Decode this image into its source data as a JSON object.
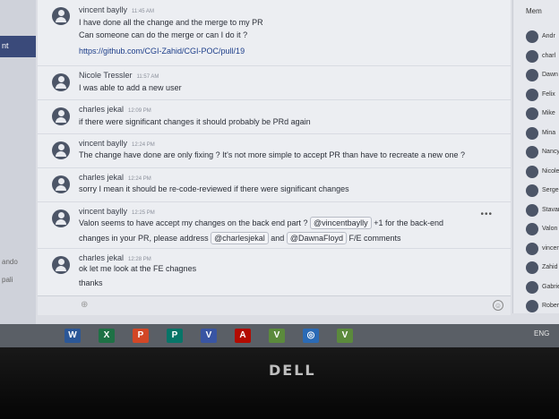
{
  "left_sidebar": {
    "active_item": "nt",
    "labels": [
      "ando",
      "pali"
    ]
  },
  "messages": [
    {
      "author": "vincent baylly",
      "time": "11:45 AM",
      "lines": [
        "I have done all the change and the merge to my PR",
        "Can someone can do the merge or can I do it ?"
      ],
      "link": "https://github.com/CGI-Zahid/CGI-POC/pull/19"
    },
    {
      "author": "Nicole Tressler",
      "time": "11:57 AM",
      "lines": [
        "I was able to add a new user"
      ]
    },
    {
      "author": "charles jekal",
      "time": "12:09 PM",
      "lines": [
        "if there were significant changes it should probably be PRd again"
      ]
    },
    {
      "author": "vincent baylly",
      "time": "12:24 PM",
      "lines": [
        "The change have done are only fixing ? It's not more simple to accept PR than have to recreate a new one ?"
      ]
    },
    {
      "author": "charles jekal",
      "time": "12:24 PM",
      "lines": [
        "sorry I mean it should be re-code-reviewed if there were significant changes"
      ]
    },
    {
      "author": "vincent baylly",
      "time": "12:25 PM",
      "line1_pre": "Valon seems to have accept my changes on the back end part ?",
      "mention1": "@vincentbaylly",
      "line1_post": "+1 for the back-end",
      "line2_pre": "changes in your PR, please address",
      "mention2": "@charlesjekal",
      "line2_mid": "and",
      "mention3": "@DawnaFloyd",
      "line2_post": "F/E comments",
      "more": "•••"
    },
    {
      "author": "charles jekal",
      "time": "12:28 PM",
      "lines": [
        "ok let me look at the FE chagnes",
        "thanks"
      ]
    }
  ],
  "members": {
    "header": "Mem",
    "items": [
      "Andr",
      "charl",
      "Dawn",
      "Felix",
      "Mike",
      "Mina",
      "Nancy",
      "Nicole",
      "Serge",
      "Stavan",
      "Valon S",
      "vincent",
      "Zahid Al",
      "Gabriel R",
      "Roberto"
    ]
  },
  "taskbar": {
    "icons": [
      {
        "name": "word",
        "label": "W",
        "color": "#2b5797"
      },
      {
        "name": "excel",
        "label": "X",
        "color": "#1e7145"
      },
      {
        "name": "powerpoint",
        "label": "P",
        "color": "#d24726"
      },
      {
        "name": "publisher",
        "label": "P",
        "color": "#077568"
      },
      {
        "name": "visio",
        "label": "V",
        "color": "#3955a3"
      },
      {
        "name": "acrobat",
        "label": "A",
        "color": "#b30b00"
      },
      {
        "name": "app-v1",
        "label": "V",
        "color": "#5b8a3c"
      },
      {
        "name": "app-circle",
        "label": "◎",
        "color": "#2a6ab5"
      },
      {
        "name": "app-v2",
        "label": "V",
        "color": "#5b8a3c"
      }
    ],
    "status": "ENG"
  },
  "brand": "DELL"
}
